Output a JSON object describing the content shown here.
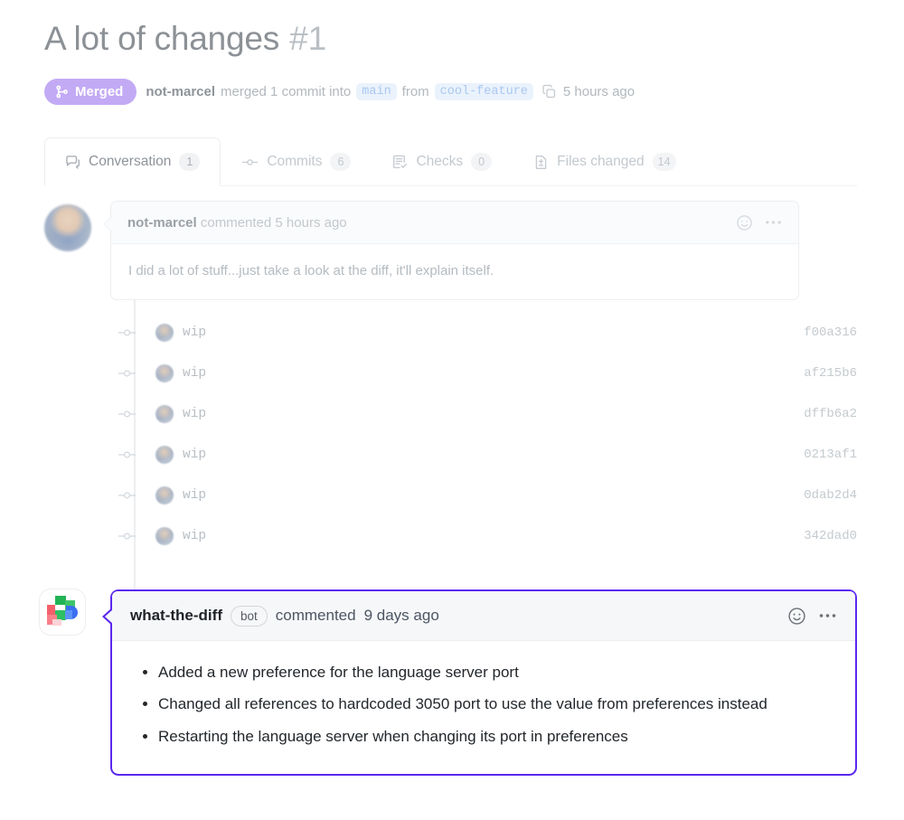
{
  "header": {
    "title": "A lot of changes",
    "number": "#1",
    "status_badge": "Merged",
    "status_icon": "git-merge-icon",
    "author": "not-marcel",
    "merged_text": "merged 1 commit into",
    "base_branch": "main",
    "from_text": "from",
    "head_branch": "cool-feature",
    "copy_icon": "copy-icon",
    "timestamp": "5 hours ago"
  },
  "tabs": [
    {
      "label": "Conversation",
      "count": "1",
      "icon": "comment-icon",
      "active": true
    },
    {
      "label": "Commits",
      "count": "6",
      "icon": "commit-icon",
      "active": false
    },
    {
      "label": "Checks",
      "count": "0",
      "icon": "checklist-icon",
      "active": false
    },
    {
      "label": "Files changed",
      "count": "14",
      "icon": "file-diff-icon",
      "active": false
    }
  ],
  "user_comment": {
    "author": "not-marcel",
    "action": "commented",
    "timestamp": "5 hours ago",
    "body": "I did a lot of stuff...just take a look at the diff, it'll explain itself.",
    "reaction_icon": "smiley-icon",
    "menu_icon": "kebab-horizontal-icon",
    "avatar": "avatar-not-marcel"
  },
  "commits": [
    {
      "message": "wip",
      "sha": "f00a316"
    },
    {
      "message": "wip",
      "sha": "af215b6"
    },
    {
      "message": "wip",
      "sha": "dffb6a2"
    },
    {
      "message": "wip",
      "sha": "0213af1"
    },
    {
      "message": "wip",
      "sha": "0dab2d4"
    },
    {
      "message": "wip",
      "sha": "342dad0"
    }
  ],
  "bot_comment": {
    "author": "what-the-diff",
    "badge": "bot",
    "action": "commented",
    "timestamp": "9 days ago",
    "reaction_icon": "smiley-icon",
    "menu_icon": "kebab-horizontal-icon",
    "avatar": "avatar-what-the-diff",
    "bullets": [
      "Added a new preference for the language server port",
      "Changed all references to hardcoded 3050 port to use the value from preferences instead",
      "Restarting the language server when changing its port in preferences"
    ]
  },
  "colors": {
    "merged_purple": "#c3aaf5",
    "bot_border": "#5b28f0",
    "branch_chip_bg": "#eaf2fc",
    "branch_chip_text": "#aac8ef"
  }
}
